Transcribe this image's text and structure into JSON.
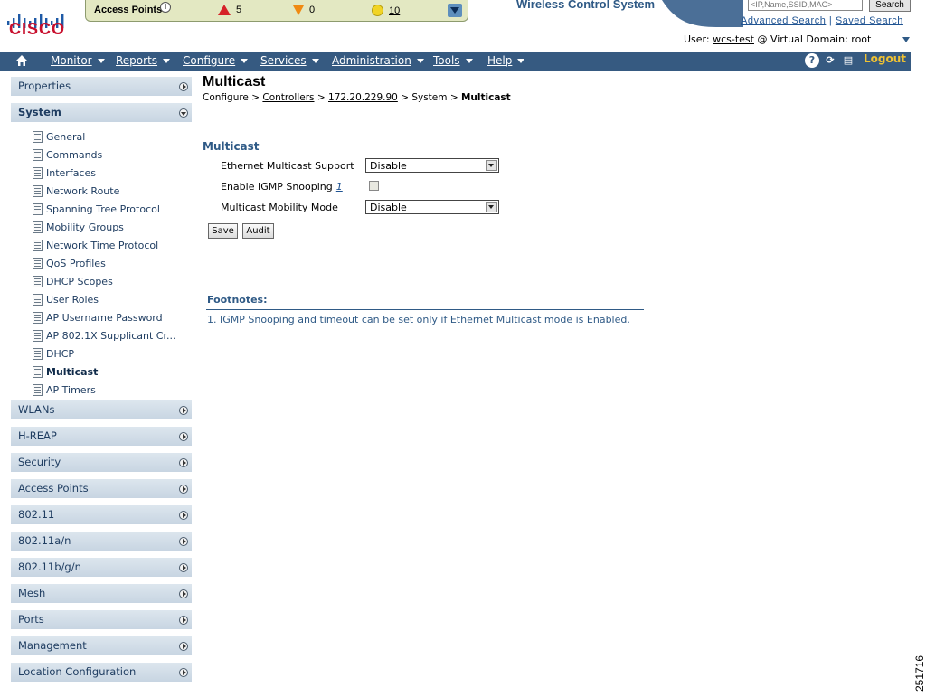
{
  "header": {
    "brand": "CISCO",
    "system_title": "Wireless Control System",
    "search_placeholder": "<IP,Name,SSID,MAC>",
    "search_label": "Search",
    "advanced_search": "Advanced Search",
    "link_separator": "|",
    "saved_search": "Saved Search",
    "user_prefix": "User:",
    "user_name": "wcs-test",
    "domain_label": "@ Virtual Domain:",
    "domain_value": "root"
  },
  "alarms": {
    "label": "Access Points",
    "critical": "5",
    "major": "0",
    "minor": "10"
  },
  "nav": {
    "items": [
      {
        "label": "Monitor"
      },
      {
        "label": "Reports"
      },
      {
        "label": "Configure"
      },
      {
        "label": "Services"
      },
      {
        "label": "Administration"
      },
      {
        "label": "Tools"
      },
      {
        "label": "Help"
      }
    ],
    "logout": "Logout"
  },
  "sidebar": {
    "properties": "Properties",
    "system": "System",
    "system_items": [
      {
        "label": "General"
      },
      {
        "label": "Commands"
      },
      {
        "label": "Interfaces"
      },
      {
        "label": "Network Route"
      },
      {
        "label": "Spanning Tree Protocol"
      },
      {
        "label": "Mobility Groups"
      },
      {
        "label": "Network Time Protocol"
      },
      {
        "label": "QoS Profiles"
      },
      {
        "label": "DHCP Scopes"
      },
      {
        "label": "User Roles"
      },
      {
        "label": "AP Username Password"
      },
      {
        "label": "AP 802.1X Supplicant Cr..."
      },
      {
        "label": "DHCP"
      },
      {
        "label": "Multicast"
      },
      {
        "label": "AP Timers"
      }
    ],
    "sections": [
      {
        "label": "WLANs"
      },
      {
        "label": "H-REAP"
      },
      {
        "label": "Security"
      },
      {
        "label": "Access Points"
      },
      {
        "label": "802.11"
      },
      {
        "label": "802.11a/n"
      },
      {
        "label": "802.11b/g/n"
      },
      {
        "label": "Mesh"
      },
      {
        "label": "Ports"
      },
      {
        "label": "Management"
      },
      {
        "label": "Location Configuration"
      }
    ]
  },
  "main": {
    "title": "Multicast",
    "breadcrumb": {
      "configure": "Configure",
      "sep": ">",
      "controllers": "Controllers",
      "ip": "172.20.229.90",
      "system": "> System",
      "current": "Multicast"
    },
    "section_title": "Multicast",
    "fields": {
      "ethernet_multicast_label": "Ethernet Multicast Support",
      "ethernet_multicast_value": "Disable",
      "igmp_label": "Enable IGMP Snooping",
      "igmp_footnote_ref": "1",
      "mobility_label": "Multicast Mobility Mode",
      "mobility_value": "Disable"
    },
    "buttons": {
      "save": "Save",
      "audit": "Audit"
    },
    "footnotes_title": "Footnotes:",
    "footnote_1": "1. IGMP Snooping and timeout can be set only if Ethernet Multicast mode is Enabled."
  },
  "figure_id": "251716"
}
